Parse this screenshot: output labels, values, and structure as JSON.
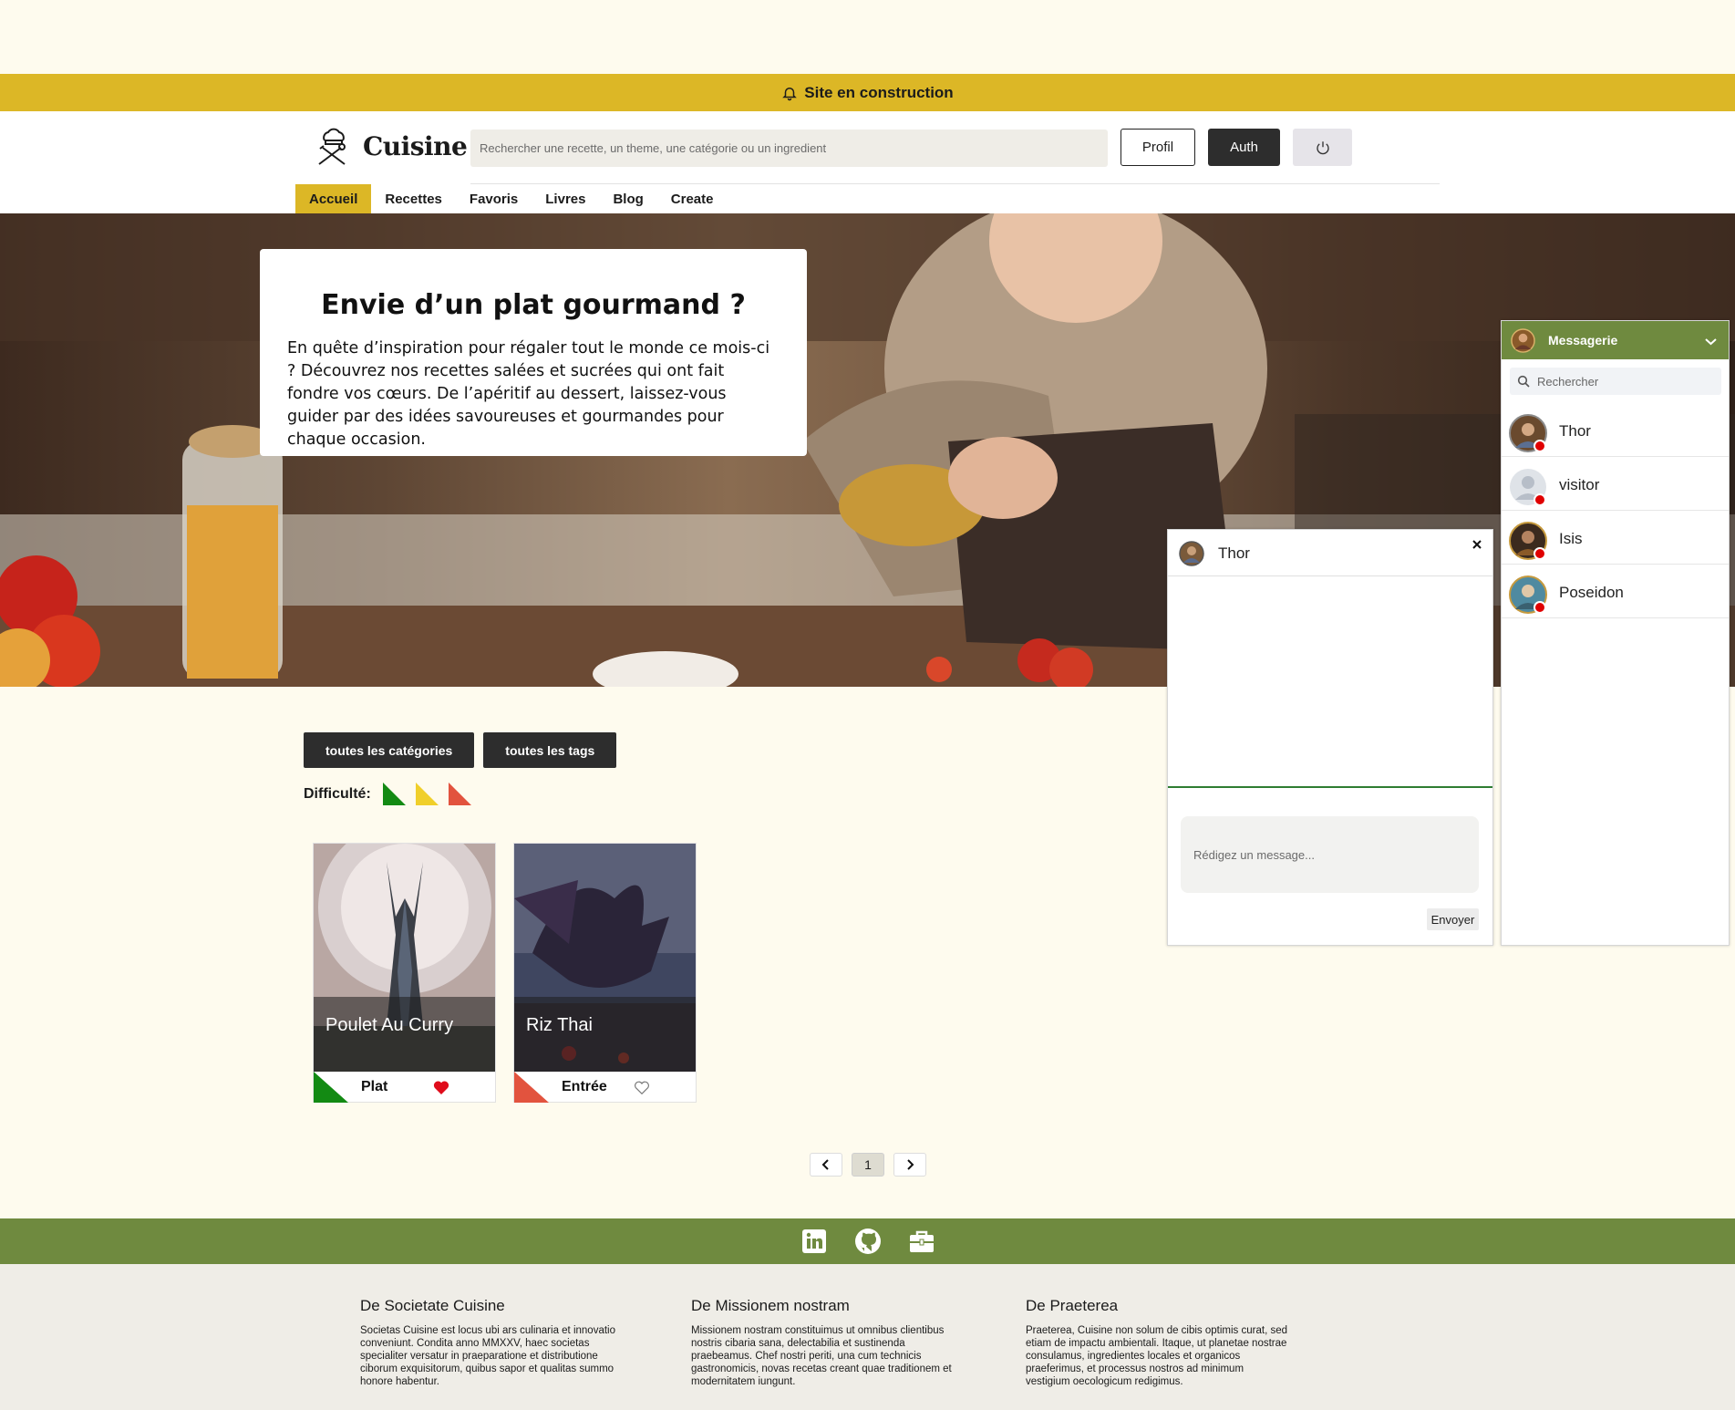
{
  "banner": {
    "text": "Site en construction",
    "icon": "bell-icon"
  },
  "header": {
    "logo_text": "Cuisine",
    "search_placeholder": "Rechercher une recette, un theme, une catégorie ou un ingredient",
    "profil_label": "Profil",
    "auth_label": "Auth",
    "power_icon": "power-icon"
  },
  "nav": {
    "items": [
      {
        "label": "Accueil",
        "active": true
      },
      {
        "label": "Recettes",
        "active": false
      },
      {
        "label": "Favoris",
        "active": false
      },
      {
        "label": "Livres",
        "active": false
      },
      {
        "label": "Blog",
        "active": false
      },
      {
        "label": "Create",
        "active": false
      }
    ]
  },
  "hero": {
    "title": "Envie d’un plat gourmand ?",
    "text": "En quête d’inspiration pour régaler tout le monde ce mois-ci ? Découvrez nos recettes salées et sucrées qui ont fait fondre vos cœurs. De l’apéritif au dessert, laissez-vous guider par des idées savoureuses et gourmandes pour chaque occasion."
  },
  "filters": {
    "categories_label": "toutes les catégories",
    "tags_label": "toutes les tags",
    "difficulty_label": "Difficulté:",
    "difficulty_colors": [
      "#138a13",
      "#f0cf2a",
      "#e2533e"
    ]
  },
  "recipes": [
    {
      "title": "Poulet Au Curry",
      "category": "Plat",
      "difficulty_color": "#138a13",
      "favorite": true
    },
    {
      "title": "Riz Thai",
      "category": "Entrée",
      "difficulty_color": "#e2533e",
      "favorite": false
    }
  ],
  "pagination": {
    "current": "1"
  },
  "footer": {
    "icons": [
      "linkedin-icon",
      "github-icon",
      "briefcase-icon"
    ],
    "columns": [
      {
        "title": "De Societate Cuisine",
        "text": "Societas Cuisine est locus ubi ars culinaria et innovatio conveniunt. Condita anno MMXXV, haec societas specialiter versatur in praeparatione et distributione ciborum exquisitorum, quibus sapor et qualitas summo honore habentur."
      },
      {
        "title": "De Missionem nostram",
        "text": "Missionem nostram constituimus ut omnibus clientibus nostris cibaria sana, delectabilia et sustinenda praebeamus. Chef nostri periti, una cum technicis gastronomicis, novas recetas creant quae traditionem et modernitatem iungunt."
      },
      {
        "title": "De Praeterea",
        "text": "Praeterea, Cuisine non solum de cibis optimis curat, sed etiam de impactu ambientali. Itaque, ut planetae nostrae consulamus, ingredientes locales et organicos praeferimus, et processus nostros ad minimum vestigium oecologicum redigimus."
      }
    ]
  },
  "chat": {
    "contact_name": "Thor",
    "input_placeholder": "Rédigez un message...",
    "send_label": "Envoyer"
  },
  "messenger": {
    "title": "Messagerie",
    "search_placeholder": "Rechercher",
    "contacts": [
      {
        "name": "Thor",
        "status": "offline"
      },
      {
        "name": "visitor",
        "status": "offline"
      },
      {
        "name": "Isis",
        "status": "offline"
      },
      {
        "name": "Poseidon",
        "status": "offline"
      }
    ]
  },
  "colors": {
    "accent": "#dcb726",
    "green": "#6f8a3f",
    "dark": "#2d2d2d",
    "page_bg": "#fefbee"
  }
}
